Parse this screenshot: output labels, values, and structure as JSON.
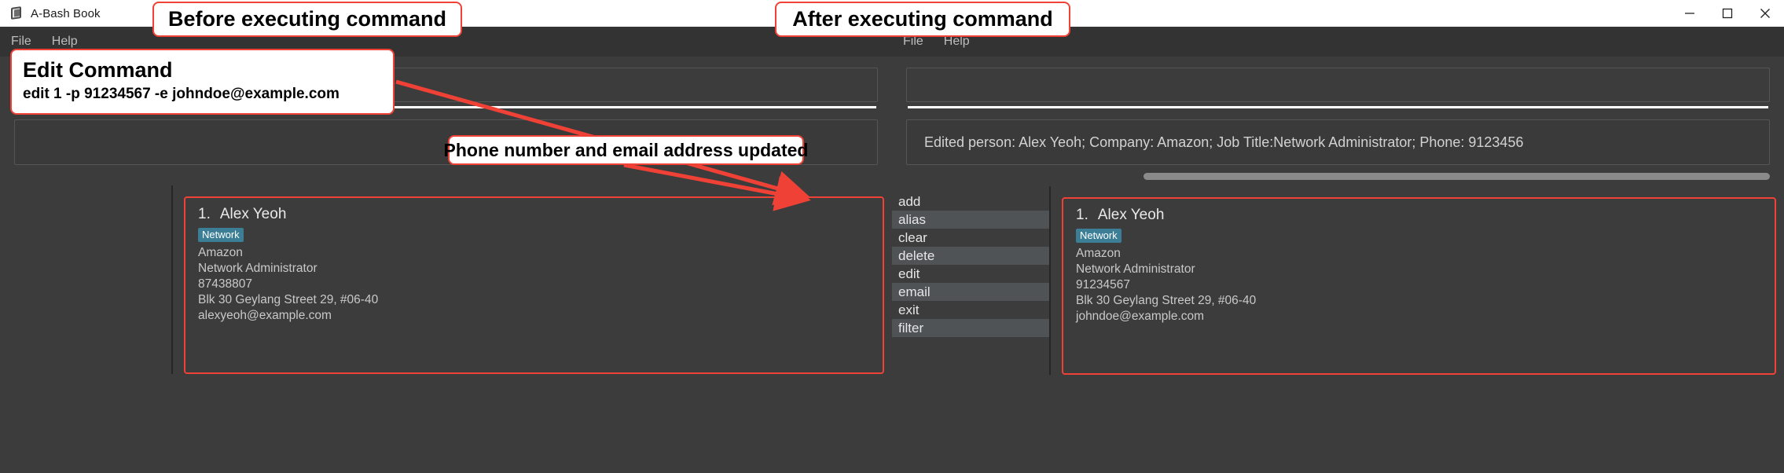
{
  "windows": [
    {
      "id": "before",
      "title": "A-Bash Book",
      "menu": [
        "File",
        "Help"
      ],
      "result_text": "",
      "person": {
        "index": "1.",
        "name": "Alex Yeoh",
        "tag": "Network",
        "company": "Amazon",
        "job_title": "Network Administrator",
        "phone": "87438807",
        "address": "Blk 30 Geylang Street 29, #06-40",
        "email": "alexyeoh@example.com"
      }
    },
    {
      "id": "after",
      "title": "A-Bash Book",
      "menu": [
        "File",
        "Help"
      ],
      "result_text": "Edited person: Alex Yeoh; Company: Amazon; Job Title:Network Administrator; Phone: 9123456",
      "command_list": [
        "add",
        "alias",
        "clear",
        "delete",
        "edit",
        "email",
        "exit",
        "filter"
      ],
      "person": {
        "index": "1.",
        "name": "Alex Yeoh",
        "tag": "Network",
        "company": "Amazon",
        "job_title": "Network Administrator",
        "phone": "91234567",
        "address": "Blk 30 Geylang Street 29, #06-40",
        "email": "johndoe@example.com"
      }
    }
  ],
  "titlebar_controls": {
    "minimize": "minimize",
    "maximize": "maximize",
    "close": "close"
  },
  "annotations": {
    "before_label": "Before executing command",
    "after_label": "After executing command",
    "edit_heading": "Edit Command",
    "edit_command": "edit 1 -p 91234567 -e johndoe@example.com",
    "phone_email_label": "Phone number and email address updated"
  },
  "colors": {
    "accent": "#ef4136",
    "tag_bg": "#3b7e96",
    "window_bg": "#3c3c3c",
    "menubar_bg": "#333333"
  }
}
